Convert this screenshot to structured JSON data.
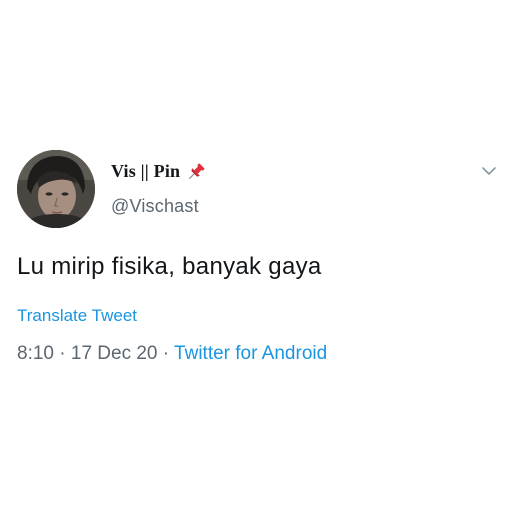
{
  "author": {
    "display_name": "Vis || Pin",
    "handle": "@Vischast",
    "name_emoji": "pushpin-icon"
  },
  "tweet": {
    "text": "Lu mirip fisika, banyak gaya",
    "translate_label": "Translate Tweet",
    "time": "8:10",
    "separator": " · ",
    "date": "17 Dec 20",
    "source": "Twitter for Android"
  },
  "menu": {
    "icon": "chevron-down-icon"
  },
  "colors": {
    "link": "#1b95e0",
    "secondary_text": "#5b6670",
    "primary_text": "#14171a"
  }
}
